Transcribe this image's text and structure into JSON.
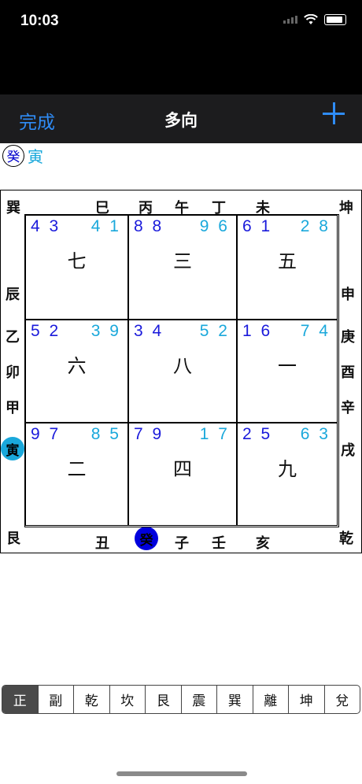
{
  "status": {
    "time": "10:03"
  },
  "nav": {
    "done": "完成",
    "title": "多向"
  },
  "legend": {
    "circle": "癸",
    "text": "寅"
  },
  "board": {
    "top": [
      "巽",
      "巳",
      "丙",
      "午",
      "丁",
      "未",
      "坤"
    ],
    "bottom": [
      "艮",
      "丑",
      "子",
      "壬",
      "亥",
      "乾"
    ],
    "left": [
      "辰",
      "乙",
      "卯",
      "甲"
    ],
    "right": [
      "申",
      "庚",
      "酉",
      "辛",
      "戌"
    ],
    "left_marker": "寅",
    "bottom_marker": "癸"
  },
  "cells": [
    {
      "left": "4 3",
      "right": "4 1",
      "star": "七"
    },
    {
      "left": "8 8",
      "right": "9 6",
      "star": "三"
    },
    {
      "left": "6 1",
      "right": "2 8",
      "star": "五"
    },
    {
      "left": "5 2",
      "right": "3 9",
      "star": "六"
    },
    {
      "left": "3 4",
      "right": "5 2",
      "star": "八"
    },
    {
      "left": "1 6",
      "right": "7 4",
      "star": "一"
    },
    {
      "left": "9 7",
      "right": "8 5",
      "star": "二"
    },
    {
      "left": "7 9",
      "right": "1 7",
      "star": "四"
    },
    {
      "left": "2 5",
      "right": "6 3",
      "star": "九"
    }
  ],
  "segments": [
    "正",
    "副",
    "乾",
    "坎",
    "艮",
    "震",
    "巽",
    "離",
    "坤",
    "兌"
  ],
  "colors": {
    "mountain_num": "#1a1adb",
    "water_num": "#1aa8db",
    "link_blue": "#2f8cf6"
  }
}
